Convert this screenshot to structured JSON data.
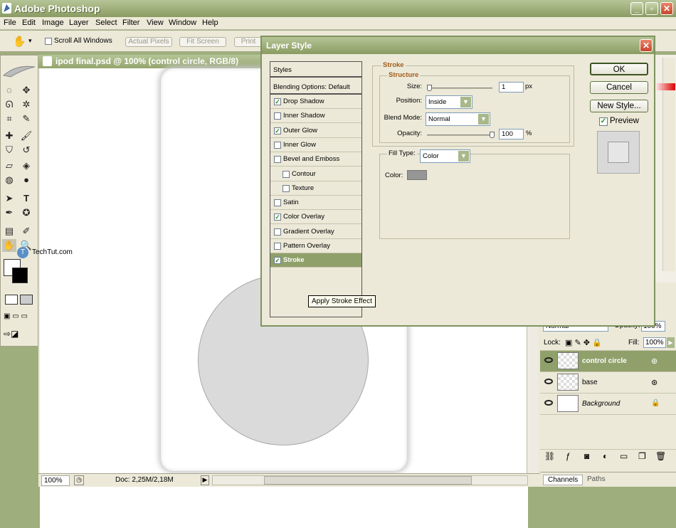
{
  "app": {
    "title": "Adobe Photoshop"
  },
  "menu": [
    "File",
    "Edit",
    "Image",
    "Layer",
    "Select",
    "Filter",
    "View",
    "Window",
    "Help"
  ],
  "options": {
    "scroll_all_windows": "Scroll All Windows",
    "actual_pixels": "Actual Pixels",
    "fit_screen": "Fit Screen",
    "print_size": "Print"
  },
  "document": {
    "title": "ipod final.psd @ 100% (control circle, RGB/8)",
    "zoom": "100%",
    "doc_size": "Doc: 2,25M/2,18M"
  },
  "logo": {
    "text": "TechTut.com"
  },
  "layers": {
    "blend_mode": "Normal",
    "opacity_label": "Opacity:",
    "opacity_value": "100%",
    "lock_label": "Lock:",
    "fill_label": "Fill:",
    "fill_value": "100%",
    "items": [
      {
        "name": "control circle",
        "selected": true
      },
      {
        "name": "base",
        "selected": false
      },
      {
        "name": "Background",
        "selected": false
      }
    ],
    "bottom_tabs": [
      "Channels",
      "Paths"
    ]
  },
  "dialog": {
    "title": "Layer Style",
    "styles_header": "Styles",
    "blending_options": "Blending Options: Default",
    "style_items": [
      {
        "label": "Drop Shadow",
        "checked": true,
        "indent": false
      },
      {
        "label": "Inner Shadow",
        "checked": false,
        "indent": false
      },
      {
        "label": "Outer Glow",
        "checked": true,
        "indent": false
      },
      {
        "label": "Inner Glow",
        "checked": false,
        "indent": false
      },
      {
        "label": "Bevel and Emboss",
        "checked": false,
        "indent": false
      },
      {
        "label": "Contour",
        "checked": false,
        "indent": true
      },
      {
        "label": "Texture",
        "checked": false,
        "indent": true
      },
      {
        "label": "Satin",
        "checked": false,
        "indent": false
      },
      {
        "label": "Color Overlay",
        "checked": true,
        "indent": false
      },
      {
        "label": "Gradient Overlay",
        "checked": false,
        "indent": false
      },
      {
        "label": "Pattern Overlay",
        "checked": false,
        "indent": false
      },
      {
        "label": "Stroke",
        "checked": true,
        "indent": false,
        "selected": true
      }
    ],
    "tooltip": "Apply Stroke Effect",
    "stroke": {
      "title": "Stroke",
      "structure_title": "Structure",
      "size_label": "Size:",
      "size_value": "1",
      "size_unit": "px",
      "position_label": "Position:",
      "position_value": "Inside",
      "blend_mode_label": "Blend Mode:",
      "blend_mode_value": "Normal",
      "opacity_label": "Opacity:",
      "opacity_value": "100",
      "opacity_unit": "%",
      "fill_type_label": "Fill Type:",
      "fill_type_value": "Color",
      "color_label": "Color:",
      "color_swatch": "#969696"
    },
    "buttons": {
      "ok": "OK",
      "cancel": "Cancel",
      "new_style": "New Style...",
      "preview": "Preview"
    }
  },
  "colors": {
    "chrome": "#8a9c62",
    "panel": "#ece9d8",
    "selection": "#8fa06a"
  }
}
